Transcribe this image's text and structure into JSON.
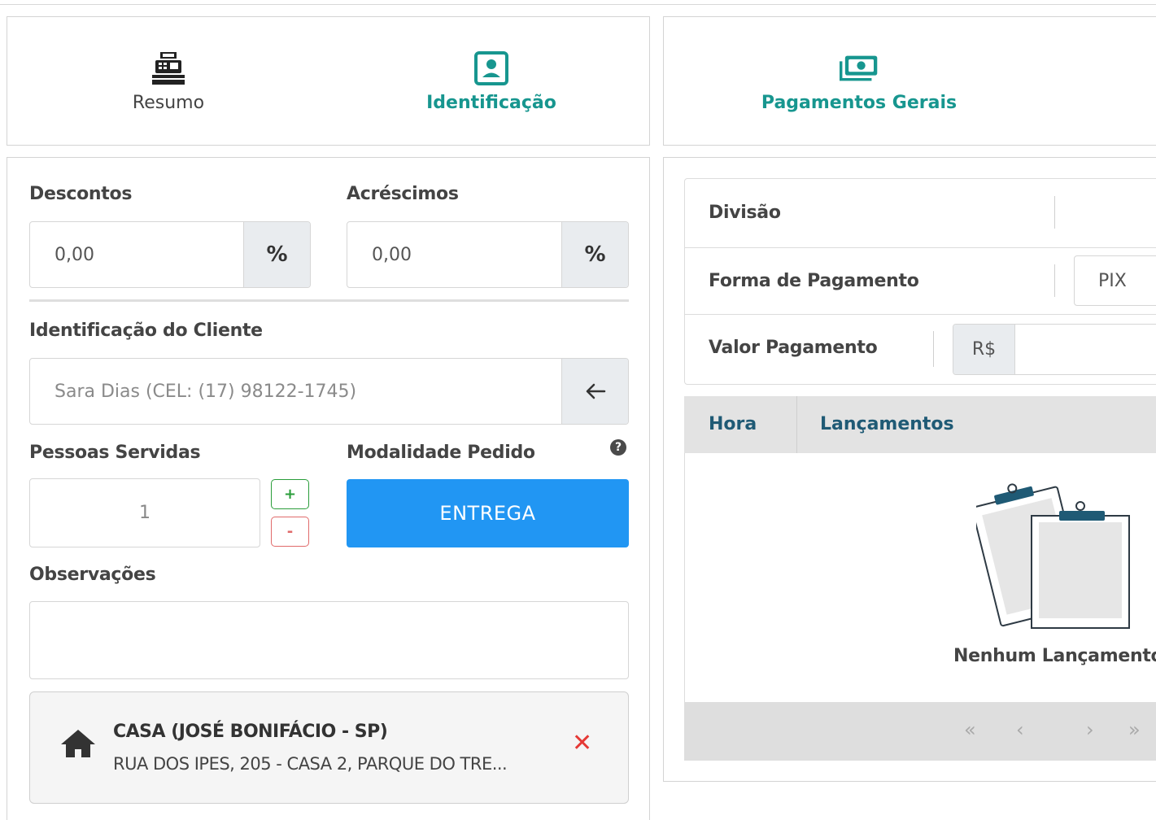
{
  "nav": {
    "resumo": "Resumo",
    "identificacao": "Identificação",
    "pagamentos_gerais": "Pagamentos Gerais"
  },
  "left": {
    "descontos_label": "Descontos",
    "descontos_value": "0,00",
    "acrescimos_label": "Acréscimos",
    "acrescimos_value": "0,00",
    "percent_symbol": "%",
    "cliente_label": "Identificação do Cliente",
    "cliente_value": "Sara Dias (CEL: (17) 98122-1745)",
    "pessoas_label": "Pessoas Servidas",
    "pessoas_value": "1",
    "plus": "+",
    "minus": "-",
    "modalidade_label": "Modalidade Pedido",
    "help": "?",
    "modalidade_value": "ENTREGA",
    "observacoes_label": "Observações",
    "observacoes_value": "",
    "address": {
      "title": "CASA (JOSÉ BONIFÁCIO - SP)",
      "line": "RUA DOS IPES, 205 - CASA 2, PARQUE DO TRE...",
      "remove": "✕"
    }
  },
  "right": {
    "divisao_label": "Divisão",
    "forma_label": "Forma de Pagamento",
    "forma_value": "PIX",
    "valor_label": "Valor Pagamento",
    "currency": "R$",
    "valor_value": "",
    "col_hora": "Hora",
    "col_lancamentos": "Lançamentos",
    "empty": "Nenhum Lançamento",
    "pager": {
      "first": "«",
      "prev": "‹",
      "next": "›",
      "last": "»"
    }
  },
  "colors": {
    "teal": "#17968f",
    "blue_button": "#2196f3",
    "dark_blue_header": "#1f5a75",
    "remove_red": "#e53935"
  }
}
